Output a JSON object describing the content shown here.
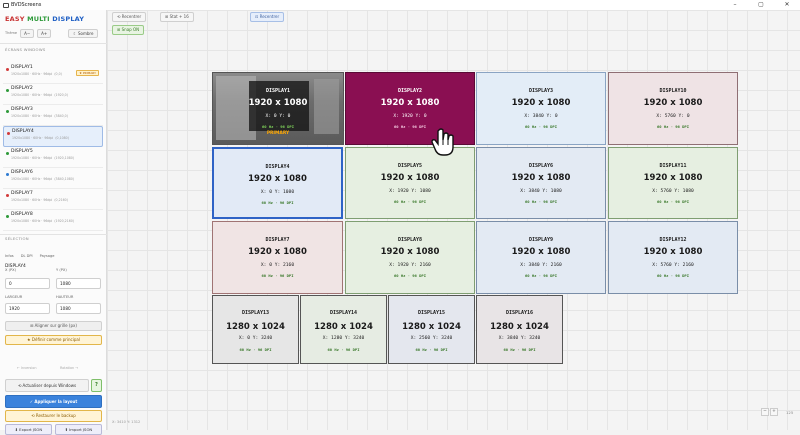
{
  "window": {
    "title": "BVDScreens",
    "min": "–",
    "max": "▢",
    "close": "✕"
  },
  "brand": {
    "word1": "EASY",
    "word2": "MULTI",
    "word3": "DISPLAY"
  },
  "theme": {
    "label": "Thème",
    "decrease": "A−",
    "increase": "A+",
    "dark": "☾ Sombre"
  },
  "sections": {
    "windows": "ÉCRANS WINDOWS",
    "selection": "SÉLECTION"
  },
  "display_list": [
    {
      "name": "DISPLAY1",
      "sub": "1920x1080 · 60Hz · 96dpi",
      "sub2": "(0,0)",
      "badge": "★ PRIMARY",
      "dot": "#d23b3b"
    },
    {
      "name": "DISPLAY2",
      "sub": "1920x1080 · 60Hz · 96dpi",
      "sub2": "(1920,0)",
      "badge": "",
      "dot": "#2e9a3a"
    },
    {
      "name": "DISPLAY3",
      "sub": "1920x1080 · 60Hz · 96dpi",
      "sub2": "(3840,0)",
      "badge": "",
      "dot": "#2e9a3a"
    },
    {
      "name": "DISPLAY4",
      "sub": "1920x1080 · 60Hz · 96dpi",
      "sub2": "(0,1080)",
      "badge": "",
      "dot": "#d23b3b"
    },
    {
      "name": "DISPLAY5",
      "sub": "1920x1080 · 60Hz · 96dpi",
      "sub2": "(1920,1080)",
      "badge": "",
      "dot": "#2e9a3a"
    },
    {
      "name": "DISPLAY6",
      "sub": "1920x1080 · 60Hz · 96dpi",
      "sub2": "(3840,1080)",
      "badge": "",
      "dot": "#2e7bd2"
    },
    {
      "name": "DISPLAY7",
      "sub": "1920x1080 · 60Hz · 96dpi",
      "sub2": "(0,2160)",
      "badge": "",
      "dot": "#d23b3b"
    },
    {
      "name": "DISPLAY8",
      "sub": "1920x1080 · 60Hz · 96dpi",
      "sub2": "(1920,2160)",
      "badge": "",
      "dot": "#2e9a3a"
    }
  ],
  "selection": {
    "tabs": [
      "Infos",
      "DL DPI",
      "Paysage"
    ],
    "name": "DISPLAY4",
    "x_label": "X (PX)",
    "y_label": "Y (PX)",
    "x_value": "0",
    "y_value": "1080",
    "w_label": "LARGEUR",
    "h_label": "HAUTEUR",
    "w_value": "1920",
    "h_value": "1080",
    "align_grid": "⊞ Aligner sur grille (px)",
    "set_primary": "★ Définir comme principal"
  },
  "faint_buttons": {
    "left": "← Inversion",
    "right": "Rotation →"
  },
  "actions": {
    "refresh": "⟲ Actualiser depuis Windows",
    "help": "?",
    "apply": "✓ Appliquer la layout",
    "restore": "⟲ Restaurer le backup",
    "export": "⬇ Export JSON",
    "import": "⬆ Import JSON"
  },
  "toolbar": {
    "reset": "⟲ Recentrer",
    "stat": "⊞ Stat + 16",
    "center": "⊡ Recentrer",
    "snap": "⊞ Snap ON"
  },
  "tiles": [
    {
      "name": "DISPLAY1",
      "res": "1920 x 1080",
      "pos": "X: 0  Y: 0",
      "hz": "60 Hz · 96 DPI",
      "primary": "PRIMARY"
    },
    {
      "name": "DISPLAY2",
      "res": "1920 x 1080",
      "pos": "X: 1920 Y: 0",
      "hz": "60 Hz · 96 DPI"
    },
    {
      "name": "DISPLAY3",
      "res": "1920 x 1080",
      "pos": "X: 3840 Y: 0",
      "hz": "60 Hz · 96 DPI"
    },
    {
      "name": "DISPLAY10",
      "res": "1920 x 1080",
      "pos": "X: 5760 Y: 0",
      "hz": "60 Hz · 96 DPI"
    },
    {
      "name": "DISPLAY4",
      "res": "1920 x 1080",
      "pos": "X: 0 Y: 1080",
      "hz": "60 Hz · 96 DPI"
    },
    {
      "name": "DISPLAY5",
      "res": "1920 x 1080",
      "pos": "X: 1920 Y: 1080",
      "hz": "60 Hz · 96 DPI"
    },
    {
      "name": "DISPLAY6",
      "res": "1920 x 1080",
      "pos": "X: 3840 Y: 1080",
      "hz": "60 Hz · 96 DPI"
    },
    {
      "name": "DISPLAY11",
      "res": "1920 x 1080",
      "pos": "X: 5760 Y: 1080",
      "hz": "60 Hz · 96 DPI"
    },
    {
      "name": "DISPLAY7",
      "res": "1920 x 1080",
      "pos": "X: 0 Y: 2160",
      "hz": "60 Hz · 96 DPI"
    },
    {
      "name": "DISPLAY8",
      "res": "1920 x 1080",
      "pos": "X: 1920 Y: 2160",
      "hz": "60 Hz · 96 DPI"
    },
    {
      "name": "DISPLAY9",
      "res": "1920 x 1080",
      "pos": "X: 3840 Y: 2160",
      "hz": "60 Hz · 96 DPI"
    },
    {
      "name": "DISPLAY12",
      "res": "1920 x 1080",
      "pos": "X: 5760 Y: 2160",
      "hz": "60 Hz · 96 DPI"
    },
    {
      "name": "DISPLAY13",
      "res": "1280 x 1024",
      "pos": "X: 0 Y: 3240",
      "hz": "60 Hz · 96 DPI"
    },
    {
      "name": "DISPLAY14",
      "res": "1280 x 1024",
      "pos": "X: 1280 Y: 3240",
      "hz": "60 Hz · 96 DPI"
    },
    {
      "name": "DISPLAY15",
      "res": "1280 x 1024",
      "pos": "X: 2560 Y: 3240",
      "hz": "60 Hz · 96 DPI"
    },
    {
      "name": "DISPLAY16",
      "res": "1280 x 1024",
      "pos": "X: 3840 Y: 3240",
      "hz": "60 Hz · 96 DPI"
    }
  ],
  "zoom": {
    "minus": "−",
    "plus": "+",
    "value": "125"
  },
  "coords": "X: 3410 Y: 1312",
  "icons": {
    "cursor": "hand-pointer-icon",
    "dark": "moon-icon"
  }
}
